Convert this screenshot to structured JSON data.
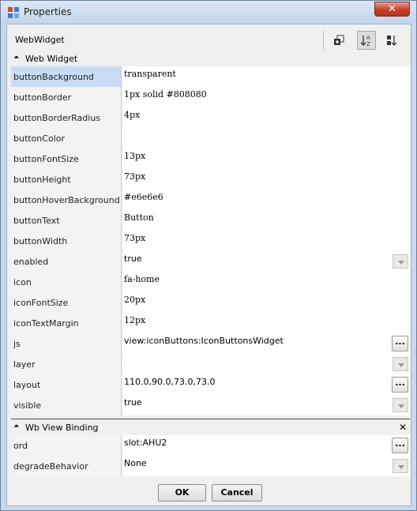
{
  "window": {
    "title": "Properties",
    "close_glyph": "✕"
  },
  "header": {
    "label": "WebWidget"
  },
  "toolbar": {
    "icons": [
      "add-icon",
      "sort-az-icon",
      "sort-icon"
    ]
  },
  "sections": [
    {
      "title": "Web Widget",
      "rows": [
        {
          "name": "buttonBackground",
          "value": "transparent",
          "type": "text",
          "mono": true
        },
        {
          "name": "buttonBorder",
          "value": "1px solid #808080",
          "type": "text",
          "mono": true
        },
        {
          "name": "buttonBorderRadius",
          "value": "4px",
          "type": "text",
          "mono": true
        },
        {
          "name": "buttonColor",
          "value": "",
          "type": "text",
          "mono": true
        },
        {
          "name": "buttonFontSize",
          "value": "13px",
          "type": "text",
          "mono": true
        },
        {
          "name": "buttonHeight",
          "value": "73px",
          "type": "text",
          "mono": true
        },
        {
          "name": "buttonHoverBackground",
          "value": "#e6e6e6",
          "type": "text",
          "mono": true
        },
        {
          "name": "buttonText",
          "value": "Button",
          "type": "text",
          "mono": true
        },
        {
          "name": "buttonWidth",
          "value": "73px",
          "type": "text",
          "mono": true
        },
        {
          "name": "enabled",
          "value": "true",
          "type": "dropdown",
          "mono": false
        },
        {
          "name": "icon",
          "value": "fa-home",
          "type": "text",
          "mono": true
        },
        {
          "name": "iconFontSize",
          "value": "20px",
          "type": "text",
          "mono": true
        },
        {
          "name": "iconTextMargin",
          "value": "12px",
          "type": "text",
          "mono": true
        },
        {
          "name": "js",
          "value": "view:iconButtons:IconButtonsWidget",
          "type": "ellipsis",
          "mono": false
        },
        {
          "name": "layer",
          "value": "",
          "type": "dropdown",
          "mono": false
        },
        {
          "name": "layout",
          "value": "110.0,90.0,73.0,73.0",
          "type": "ellipsis",
          "mono": false
        },
        {
          "name": "visible",
          "value": "true",
          "type": "dropdown",
          "mono": false
        }
      ]
    },
    {
      "title": "Wb View Binding",
      "rows": [
        {
          "name": "ord",
          "value": "slot:AHU2",
          "type": "ellipsis",
          "mono": false
        },
        {
          "name": "degradeBehavior",
          "value": "None",
          "type": "dropdown",
          "mono": false
        }
      ]
    }
  ],
  "ellipsis_label": "...",
  "section_toggle_glyph": "⏶",
  "section_close_glyph": "✕",
  "buttons": {
    "ok": "OK",
    "cancel": "Cancel"
  },
  "selected_row": "buttonBackground"
}
